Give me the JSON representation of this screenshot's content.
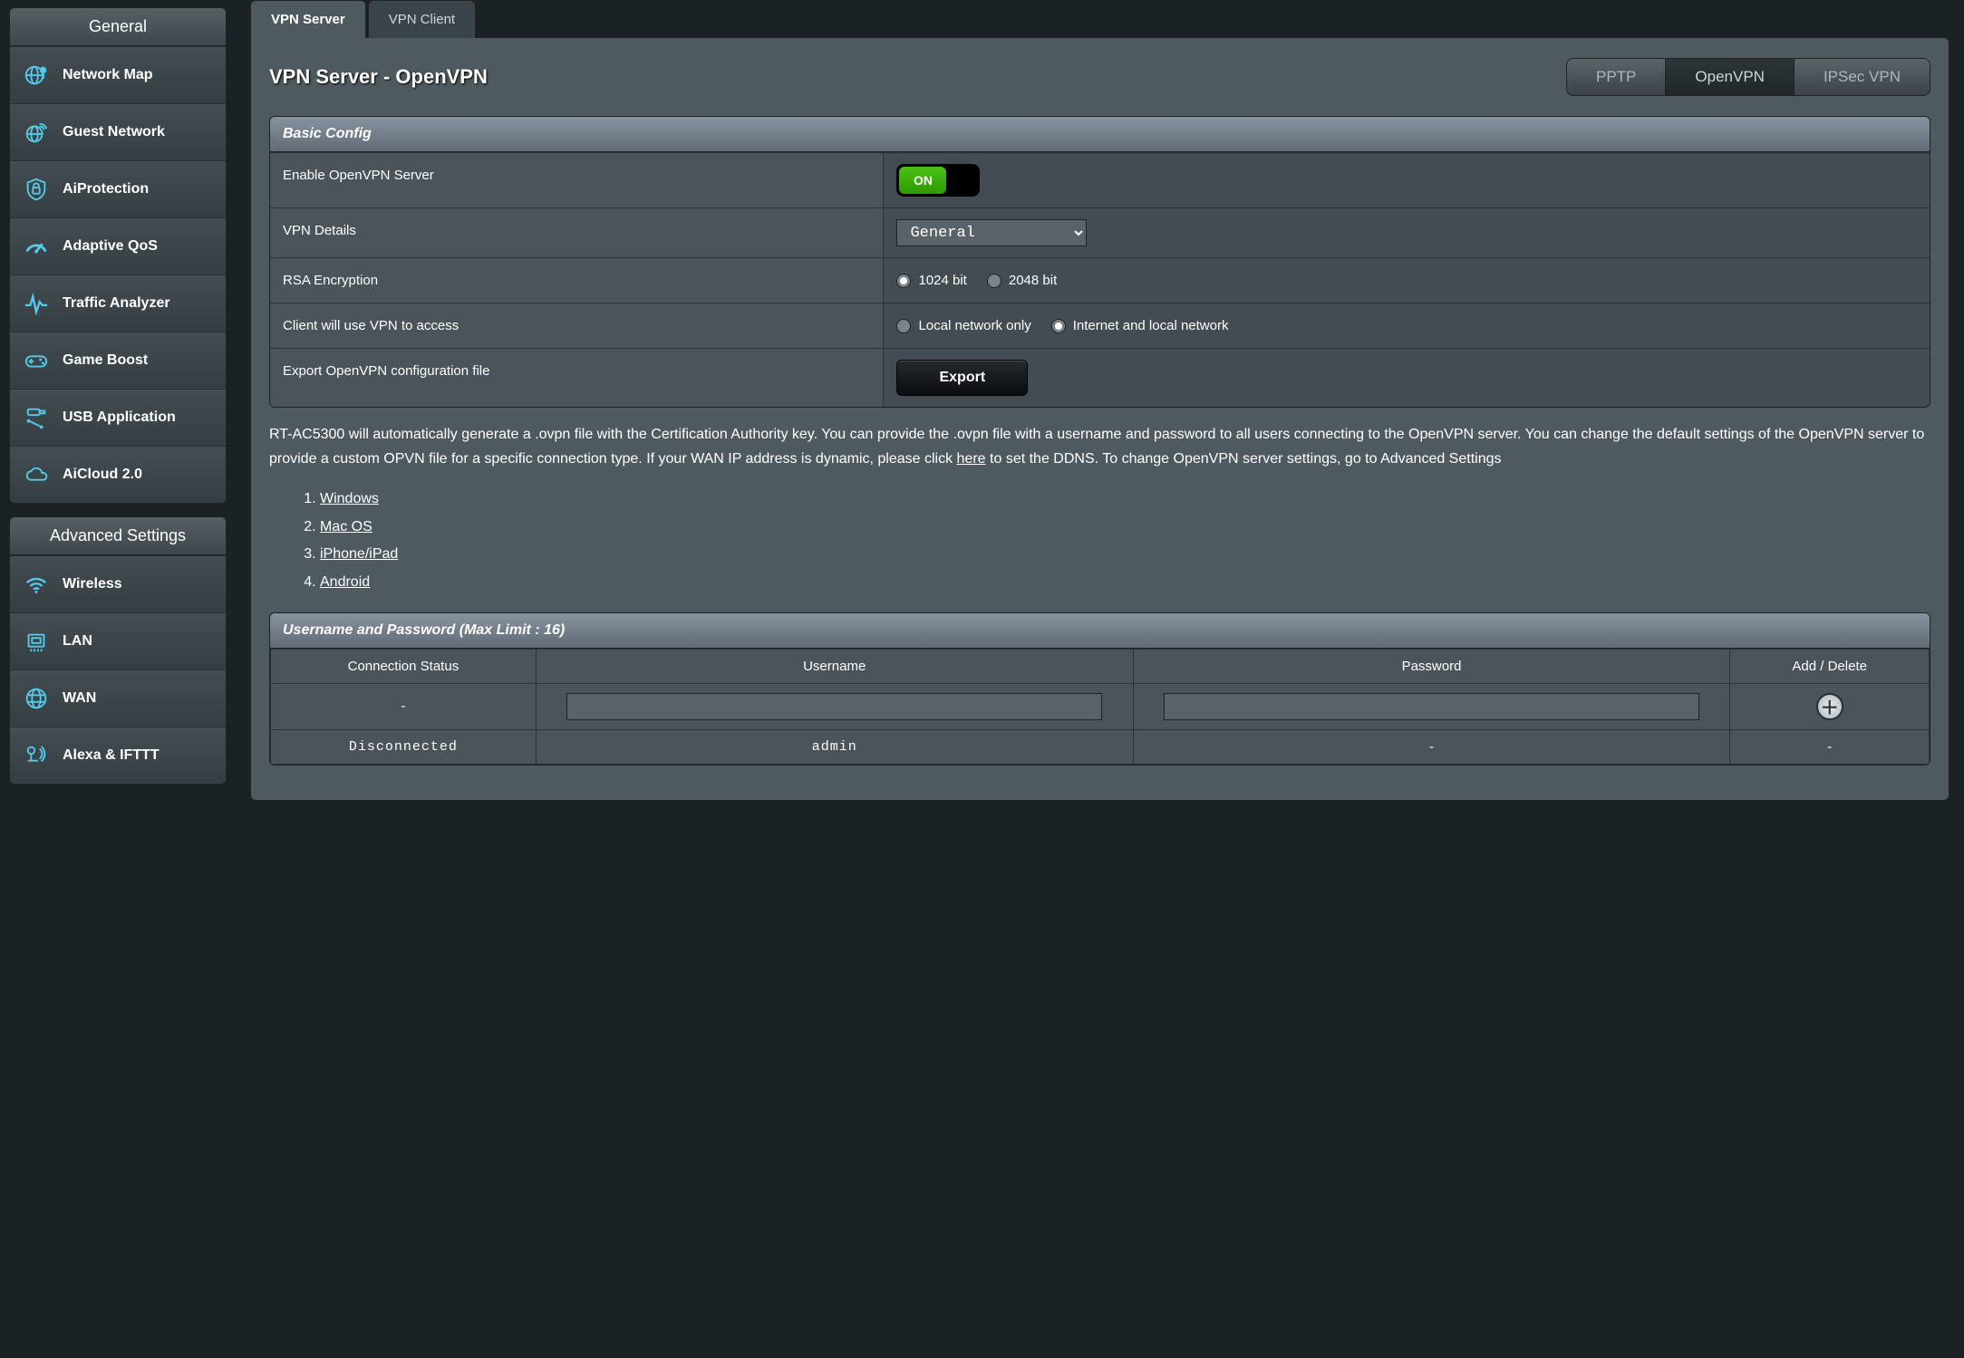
{
  "sidebar": {
    "general": {
      "header": "General",
      "items": [
        {
          "label": "Network Map",
          "icon": "globe-pin"
        },
        {
          "label": "Guest Network",
          "icon": "globe-wifi"
        },
        {
          "label": "AiProtection",
          "icon": "shield-lock"
        },
        {
          "label": "Adaptive QoS",
          "icon": "gauge"
        },
        {
          "label": "Traffic Analyzer",
          "icon": "pulse"
        },
        {
          "label": "Game Boost",
          "icon": "gamepad"
        },
        {
          "label": "USB Application",
          "icon": "usb"
        },
        {
          "label": "AiCloud 2.0",
          "icon": "cloud"
        }
      ]
    },
    "advanced": {
      "header": "Advanced Settings",
      "items": [
        {
          "label": "Wireless",
          "icon": "wifi"
        },
        {
          "label": "LAN",
          "icon": "lan"
        },
        {
          "label": "WAN",
          "icon": "globe"
        },
        {
          "label": "Alexa & IFTTT",
          "icon": "voice"
        }
      ]
    }
  },
  "tabs": {
    "server": "VPN Server",
    "client": "VPN Client"
  },
  "page": {
    "title": "VPN Server - OpenVPN"
  },
  "vpn_modes": {
    "pptp": "PPTP",
    "openvpn": "OpenVPN",
    "ipsec": "IPSec VPN"
  },
  "basic_config": {
    "header": "Basic Config",
    "enable_label": "Enable OpenVPN Server",
    "enable_state": "ON",
    "details_label": "VPN Details",
    "details_value": "General",
    "rsa_label": "RSA Encryption",
    "rsa_1024": "1024 bit",
    "rsa_2048": "2048 bit",
    "access_label": "Client will use VPN to access",
    "access_local": "Local network only",
    "access_both": "Internet and local network",
    "export_label": "Export OpenVPN configuration file",
    "export_btn": "Export"
  },
  "description": {
    "text_pre": "RT-AC5300 will automatically generate a .ovpn file with the Certification Authority key. You can provide the .ovpn file with a username and password to all users connecting to the OpenVPN server. You can change the default settings of the OpenVPN server to provide a custom OPVN file for a specific connection type. If your WAN IP address is dynamic, please click ",
    "here": "here",
    "text_post": " to set the DDNS. To change OpenVPN server settings, go to Advanced Settings"
  },
  "platforms": [
    "Windows",
    "Mac OS",
    "iPhone/iPad",
    "Android"
  ],
  "userpass": {
    "header": "Username and Password (Max Limit : 16)",
    "col_status": "Connection Status",
    "col_user": "Username",
    "col_pass": "Password",
    "col_action": "Add / Delete",
    "empty_status": "-",
    "rows": [
      {
        "status": "Disconnected",
        "user": "admin",
        "pass": "-",
        "action": "-"
      }
    ]
  }
}
